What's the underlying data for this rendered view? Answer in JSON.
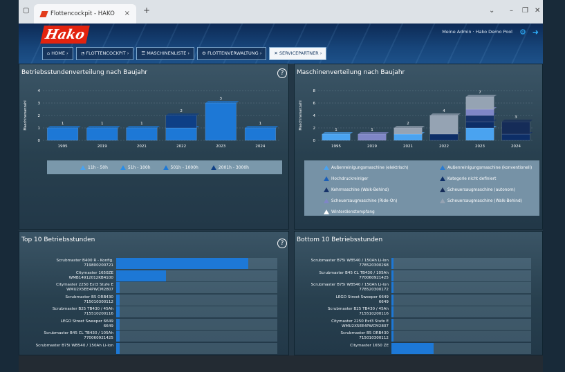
{
  "browser": {
    "tab_title": "Flottencockpit - HAKO",
    "new_tab": "+",
    "close": "×",
    "minimize": "–",
    "restore": "❐",
    "close_win": "✕",
    "expand": "⌄"
  },
  "header": {
    "logo": "Hako",
    "user": "Meine Admin · Hako Demo Pool",
    "colors": {
      "brand": "#e2230f",
      "accent": "#2fb2ff"
    }
  },
  "nav": [
    {
      "label": "HOME",
      "icon": "home-icon"
    },
    {
      "label": "FLOTTENCOCKPIT",
      "icon": "cockpit-icon"
    },
    {
      "label": "MASCHINENLISTE",
      "icon": "list-icon"
    },
    {
      "label": "FLOTTENVERWALTUNG",
      "icon": "fleet-icon"
    },
    {
      "label": "SERVICEPARTNER",
      "icon": "service-icon",
      "active": true
    }
  ],
  "panels": {
    "p1": {
      "title": "Betriebsstundenverteilung nach Baujahr",
      "help": "?"
    },
    "p2": {
      "title": "Maschinenverteilung nach Baujahr"
    },
    "p3": {
      "title": "Top 10 Betriebsstunden",
      "help": "?"
    },
    "p4": {
      "title": "Bottom 10 Betriebsstunden"
    }
  },
  "chart_data": [
    {
      "type": "bar",
      "ylabel": "Maschinenanzahl",
      "ylim": [
        0,
        4
      ],
      "categories": [
        "1995",
        "2019",
        "2021",
        "2022",
        "2023",
        "2024"
      ],
      "totals": [
        1,
        1,
        1,
        2,
        3,
        1
      ],
      "series": [
        {
          "name": "11h - 50h",
          "values": [
            0,
            0,
            0,
            0,
            0,
            0
          ],
          "color": "#4aa3f0"
        },
        {
          "name": "51h - 100h",
          "values": [
            0,
            0,
            0,
            0,
            0,
            0
          ],
          "color": "#2b8de6"
        },
        {
          "name": "501h - 1000h",
          "values": [
            1,
            1,
            1,
            1,
            3,
            1
          ],
          "color": "#1d78d6"
        },
        {
          "name": "2001h - 3000h",
          "values": [
            0,
            0,
            0,
            1,
            0,
            0
          ],
          "color": "#0e3f86"
        }
      ],
      "legend": "bottom"
    },
    {
      "type": "bar",
      "ylabel": "Maschinenanzahl",
      "ylim": [
        0,
        8
      ],
      "categories": [
        "1995",
        "2019",
        "2021",
        "2022",
        "2023",
        "2024"
      ],
      "totals": [
        1,
        1,
        2,
        4,
        7,
        3
      ],
      "series": [
        {
          "name": "Außenreinigungsmaschine (elektrisch)",
          "values": [
            1,
            0,
            1,
            0,
            2,
            0
          ],
          "color": "#4aa3f0"
        },
        {
          "name": "Außenreinigungsmaschine (konventionell)",
          "values": [
            0,
            0,
            0,
            0,
            0,
            0
          ],
          "color": "#2b7bd0"
        },
        {
          "name": "Hochdruckreiniger",
          "values": [
            0,
            0,
            0,
            0,
            0,
            0
          ],
          "color": "#1b5fb7"
        },
        {
          "name": "Kategorie nicht definiert",
          "values": [
            0,
            0,
            0,
            1,
            1,
            1
          ],
          "color": "#0d2e67"
        },
        {
          "name": "Kehrmaschine (Walk-Behind)",
          "values": [
            0,
            0,
            0,
            0,
            1,
            0
          ],
          "color": "#17336a"
        },
        {
          "name": "Scheuersaugmaschine (autonom)",
          "values": [
            0,
            0,
            0,
            0,
            0,
            2
          ],
          "color": "#152c58"
        },
        {
          "name": "Scheuersaugmaschine (Ride-On)",
          "values": [
            0,
            1,
            0,
            0,
            1,
            0
          ],
          "color": "#7f86c6"
        },
        {
          "name": "Scheuersaugmaschine (Walk-Behind)",
          "values": [
            0,
            0,
            1,
            3,
            2,
            0
          ],
          "color": "#95a3b3"
        },
        {
          "name": "Winterdienstempfang",
          "values": [
            0,
            0,
            0,
            0,
            0,
            0
          ],
          "color": "#ffffff"
        }
      ],
      "legend": "bottom"
    },
    {
      "type": "bar",
      "orientation": "horizontal",
      "xlim": [
        0,
        100
      ],
      "categories": [
        "Scrubmaster B400 R - Konfig.\n719800200721",
        "Citymaster 1650ZE\nWMB14912012KB4100",
        "Citymaster 2250 Ext3 Stufe E\nWMU2X5EE4PWCM2807",
        "Scrubmaster B5 ORB430\n715010300112",
        "Scrubmaster B25 TB430 / 45Ah\n715510200116",
        "LEGO Street Sweeper 6649\n6649",
        "Scrubmaster B45 CL TB430 / 105Ah\n770060921425",
        "Scrubmaster B75i WB540 / 150Ah Li-Ion"
      ],
      "values": [
        82,
        31,
        2,
        2,
        2,
        2,
        2,
        2
      ]
    },
    {
      "type": "bar",
      "orientation": "horizontal",
      "xlim": [
        0,
        100
      ],
      "categories": [
        "Scrubmaster B75i WB540 / 150Ah Li-Ion\n778520300268",
        "Scrubmaster B45 CL TB430 / 105Ah\n770060921425",
        "Scrubmaster B75i WB540 / 150Ah Li-Ion\n778520300172",
        "LEGO Street Sweeper 6649\n6649",
        "Scrubmaster B25 TB430 / 45Ah\n715510200116",
        "Citymaster 2250 Ext3 Stufe E\nWMU2X5EE4PWCM2807",
        "Scrubmaster B5 ORB430\n715010300112",
        "Citymaster 1650 ZE"
      ],
      "values": [
        1,
        1,
        1,
        1,
        1,
        1,
        1,
        30
      ]
    }
  ]
}
